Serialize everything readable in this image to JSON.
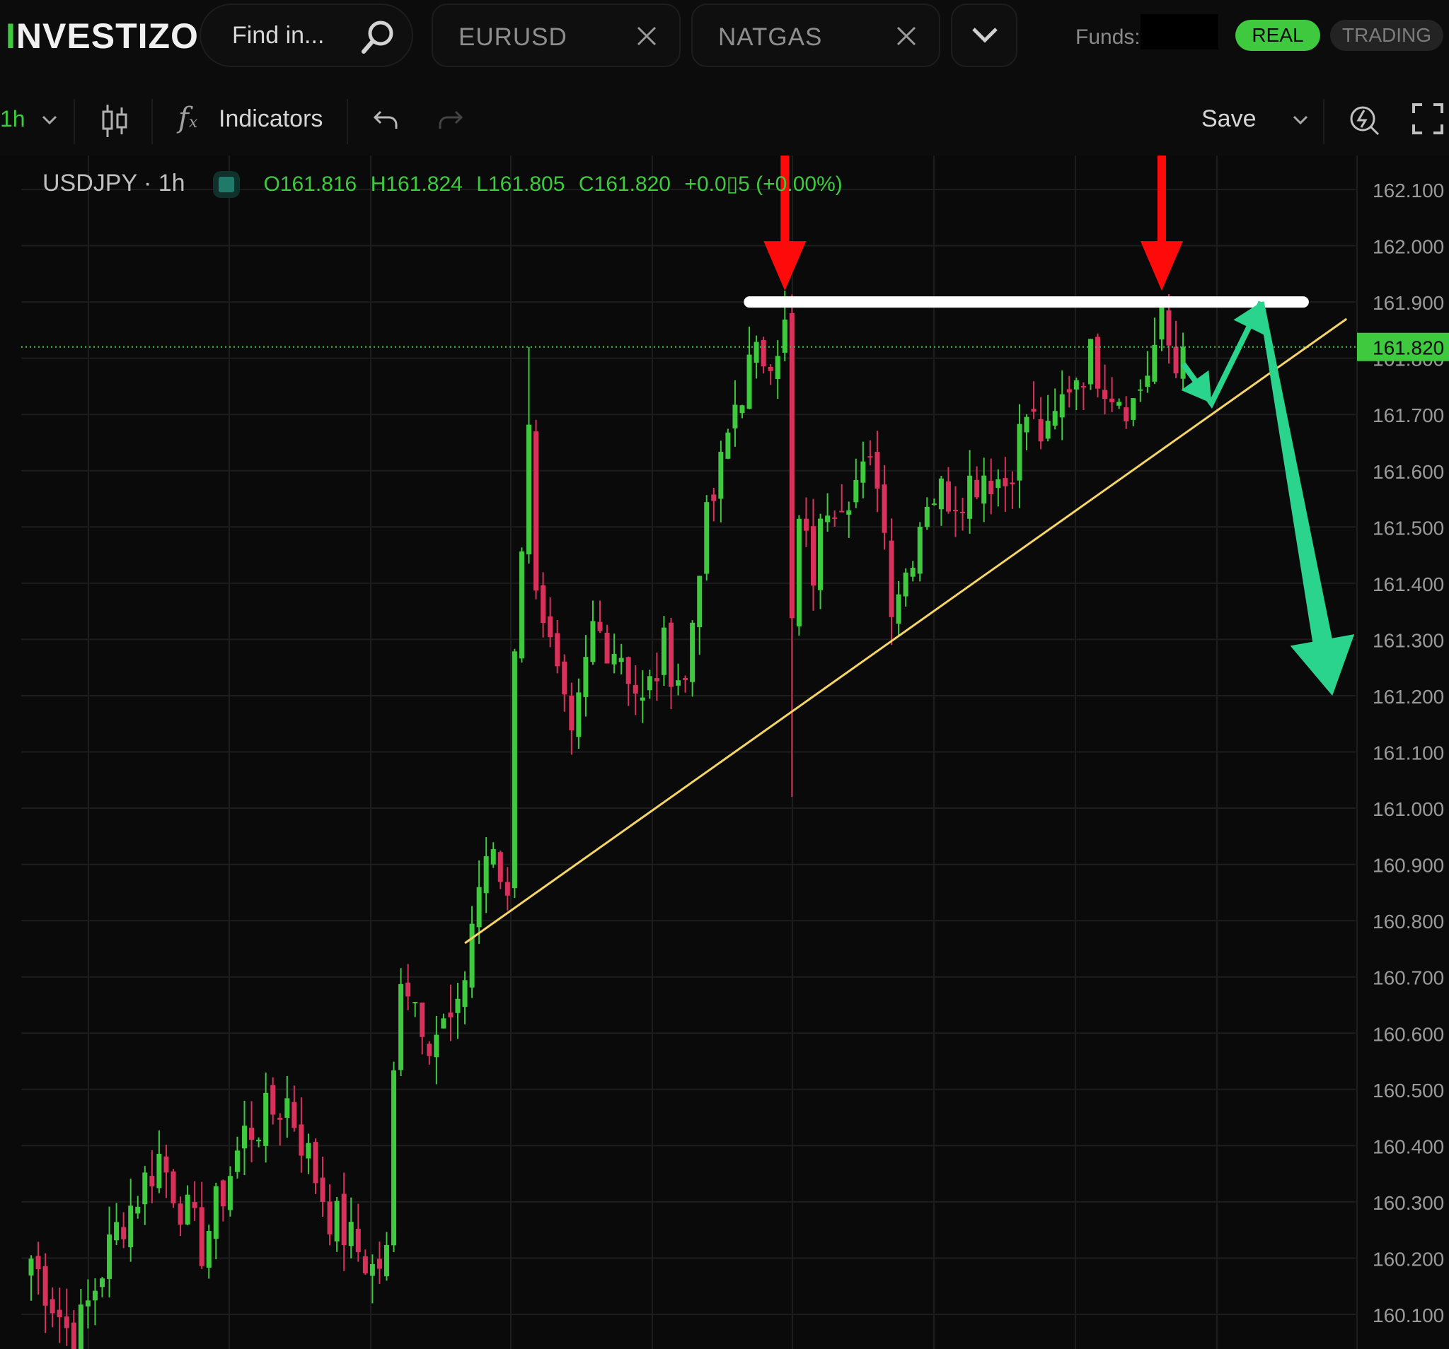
{
  "header": {
    "logo_text": "INVESTIZO",
    "search_placeholder": "Find in...",
    "tabs": [
      {
        "label": "EURUSD"
      },
      {
        "label": "NATGAS"
      }
    ],
    "funds_label": "Funds:",
    "real_label": "REAL",
    "trading_label": "TRADING"
  },
  "toolbar": {
    "interval": "1h",
    "indicators_label": "Indicators",
    "save_label": "Save"
  },
  "legend": {
    "symbol": "USDJPY · 1h",
    "open": "O161.816",
    "high": "H161.824",
    "low": "L161.805",
    "close": "C161.820",
    "change": "+0.0▯5 (+0.00%)"
  },
  "colors": {
    "up": "#3ec93e",
    "down": "#d8315b",
    "annotation_arrow": "#ff0a0a",
    "resistance_line": "#ffffff",
    "trend_line": "#f5d565",
    "projection_arrow": "#2bd48c"
  },
  "chart_data": {
    "type": "candlestick",
    "symbol": "USDJPY",
    "interval": "1h",
    "ylim": [
      160.05,
      162.13
    ],
    "y_ticks": [
      "162.100",
      "162.000",
      "161.900",
      "161.800",
      "161.700",
      "161.600",
      "161.500",
      "161.400",
      "161.300",
      "161.200",
      "161.100",
      "161.000",
      "160.900",
      "160.800",
      "160.700",
      "160.600",
      "160.500",
      "160.400",
      "160.300",
      "160.200",
      "160.100"
    ],
    "current_price": "161.820",
    "anchors": [
      {
        "i": 0,
        "p": 160.2
      },
      {
        "i": 6,
        "p": 160.05
      },
      {
        "i": 12,
        "p": 160.25
      },
      {
        "i": 18,
        "p": 160.38
      },
      {
        "i": 24,
        "p": 160.22
      },
      {
        "i": 30,
        "p": 160.42
      },
      {
        "i": 36,
        "p": 160.48
      },
      {
        "i": 42,
        "p": 160.28
      },
      {
        "i": 48,
        "p": 160.18
      },
      {
        "i": 50,
        "p": 160.2
      },
      {
        "i": 51,
        "p": 160.52
      },
      {
        "i": 52,
        "p": 160.72
      },
      {
        "i": 56,
        "p": 160.6
      },
      {
        "i": 60,
        "p": 160.62
      },
      {
        "i": 62,
        "p": 160.8
      },
      {
        "i": 64,
        "p": 160.92
      },
      {
        "i": 67,
        "p": 160.85
      },
      {
        "i": 68,
        "p": 161.3
      },
      {
        "i": 70,
        "p": 161.66
      },
      {
        "i": 71,
        "p": 161.42
      },
      {
        "i": 73,
        "p": 161.28
      },
      {
        "i": 76,
        "p": 161.1
      },
      {
        "i": 79,
        "p": 161.32
      },
      {
        "i": 83,
        "p": 161.28
      },
      {
        "i": 86,
        "p": 161.18
      },
      {
        "i": 89,
        "p": 161.28
      },
      {
        "i": 92,
        "p": 161.22
      },
      {
        "i": 94,
        "p": 161.45
      },
      {
        "i": 97,
        "p": 161.6
      },
      {
        "i": 99,
        "p": 161.72
      },
      {
        "i": 101,
        "p": 161.78
      },
      {
        "i": 104,
        "p": 161.82
      },
      {
        "i": 106,
        "p": 161.85
      },
      {
        "i": 107,
        "p": 161.32
      },
      {
        "i": 108,
        "p": 161.5
      },
      {
        "i": 110,
        "p": 161.42
      },
      {
        "i": 112,
        "p": 161.55
      },
      {
        "i": 116,
        "p": 161.58
      },
      {
        "i": 119,
        "p": 161.6
      },
      {
        "i": 121,
        "p": 161.38
      },
      {
        "i": 123,
        "p": 161.42
      },
      {
        "i": 126,
        "p": 161.56
      },
      {
        "i": 130,
        "p": 161.56
      },
      {
        "i": 134,
        "p": 161.6
      },
      {
        "i": 137,
        "p": 161.58
      },
      {
        "i": 140,
        "p": 161.7
      },
      {
        "i": 143,
        "p": 161.65
      },
      {
        "i": 146,
        "p": 161.76
      },
      {
        "i": 149,
        "p": 161.8
      },
      {
        "i": 152,
        "p": 161.75
      },
      {
        "i": 155,
        "p": 161.72
      },
      {
        "i": 157,
        "p": 161.78
      },
      {
        "i": 159,
        "p": 161.86
      },
      {
        "i": 161,
        "p": 161.78
      },
      {
        "i": 162,
        "p": 161.82
      }
    ],
    "annotations": {
      "resistance_level": 161.9,
      "peak_arrows_at_bar": [
        106,
        159
      ],
      "trend_line": [
        {
          "i": 61,
          "p": 160.76
        },
        {
          "i": 185,
          "p": 161.87
        }
      ],
      "projection_path": [
        {
          "i": 162,
          "p": 161.79
        },
        {
          "i": 166,
          "p": 161.72
        },
        {
          "i": 173,
          "p": 161.9
        },
        {
          "i": 183,
          "p": 161.2
        }
      ]
    }
  }
}
